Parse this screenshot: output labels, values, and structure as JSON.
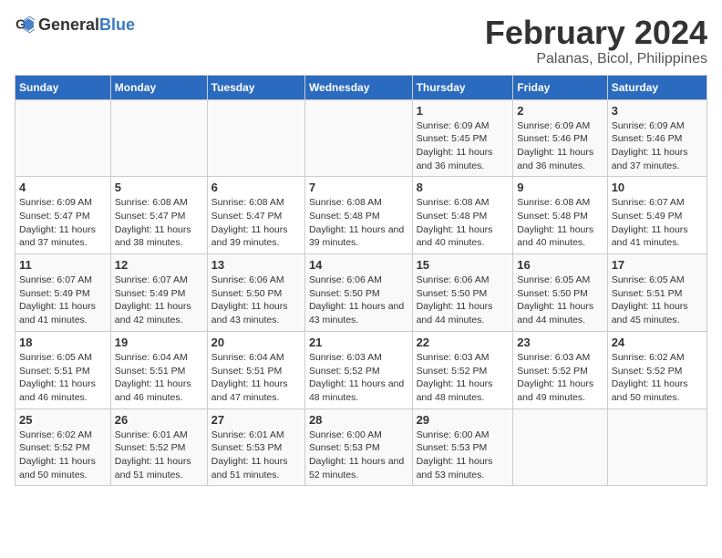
{
  "header": {
    "logo_general": "General",
    "logo_blue": "Blue",
    "month_title": "February 2024",
    "location": "Palanas, Bicol, Philippines"
  },
  "calendar": {
    "days_of_week": [
      "Sunday",
      "Monday",
      "Tuesday",
      "Wednesday",
      "Thursday",
      "Friday",
      "Saturday"
    ],
    "weeks": [
      [
        {
          "day": "",
          "detail": ""
        },
        {
          "day": "",
          "detail": ""
        },
        {
          "day": "",
          "detail": ""
        },
        {
          "day": "",
          "detail": ""
        },
        {
          "day": "1",
          "detail": "Sunrise: 6:09 AM\nSunset: 5:45 PM\nDaylight: 11 hours and 36 minutes."
        },
        {
          "day": "2",
          "detail": "Sunrise: 6:09 AM\nSunset: 5:46 PM\nDaylight: 11 hours and 36 minutes."
        },
        {
          "day": "3",
          "detail": "Sunrise: 6:09 AM\nSunset: 5:46 PM\nDaylight: 11 hours and 37 minutes."
        }
      ],
      [
        {
          "day": "4",
          "detail": "Sunrise: 6:09 AM\nSunset: 5:47 PM\nDaylight: 11 hours and 37 minutes."
        },
        {
          "day": "5",
          "detail": "Sunrise: 6:08 AM\nSunset: 5:47 PM\nDaylight: 11 hours and 38 minutes."
        },
        {
          "day": "6",
          "detail": "Sunrise: 6:08 AM\nSunset: 5:47 PM\nDaylight: 11 hours and 39 minutes."
        },
        {
          "day": "7",
          "detail": "Sunrise: 6:08 AM\nSunset: 5:48 PM\nDaylight: 11 hours and 39 minutes."
        },
        {
          "day": "8",
          "detail": "Sunrise: 6:08 AM\nSunset: 5:48 PM\nDaylight: 11 hours and 40 minutes."
        },
        {
          "day": "9",
          "detail": "Sunrise: 6:08 AM\nSunset: 5:48 PM\nDaylight: 11 hours and 40 minutes."
        },
        {
          "day": "10",
          "detail": "Sunrise: 6:07 AM\nSunset: 5:49 PM\nDaylight: 11 hours and 41 minutes."
        }
      ],
      [
        {
          "day": "11",
          "detail": "Sunrise: 6:07 AM\nSunset: 5:49 PM\nDaylight: 11 hours and 41 minutes."
        },
        {
          "day": "12",
          "detail": "Sunrise: 6:07 AM\nSunset: 5:49 PM\nDaylight: 11 hours and 42 minutes."
        },
        {
          "day": "13",
          "detail": "Sunrise: 6:06 AM\nSunset: 5:50 PM\nDaylight: 11 hours and 43 minutes."
        },
        {
          "day": "14",
          "detail": "Sunrise: 6:06 AM\nSunset: 5:50 PM\nDaylight: 11 hours and 43 minutes."
        },
        {
          "day": "15",
          "detail": "Sunrise: 6:06 AM\nSunset: 5:50 PM\nDaylight: 11 hours and 44 minutes."
        },
        {
          "day": "16",
          "detail": "Sunrise: 6:05 AM\nSunset: 5:50 PM\nDaylight: 11 hours and 44 minutes."
        },
        {
          "day": "17",
          "detail": "Sunrise: 6:05 AM\nSunset: 5:51 PM\nDaylight: 11 hours and 45 minutes."
        }
      ],
      [
        {
          "day": "18",
          "detail": "Sunrise: 6:05 AM\nSunset: 5:51 PM\nDaylight: 11 hours and 46 minutes."
        },
        {
          "day": "19",
          "detail": "Sunrise: 6:04 AM\nSunset: 5:51 PM\nDaylight: 11 hours and 46 minutes."
        },
        {
          "day": "20",
          "detail": "Sunrise: 6:04 AM\nSunset: 5:51 PM\nDaylight: 11 hours and 47 minutes."
        },
        {
          "day": "21",
          "detail": "Sunrise: 6:03 AM\nSunset: 5:52 PM\nDaylight: 11 hours and 48 minutes."
        },
        {
          "day": "22",
          "detail": "Sunrise: 6:03 AM\nSunset: 5:52 PM\nDaylight: 11 hours and 48 minutes."
        },
        {
          "day": "23",
          "detail": "Sunrise: 6:03 AM\nSunset: 5:52 PM\nDaylight: 11 hours and 49 minutes."
        },
        {
          "day": "24",
          "detail": "Sunrise: 6:02 AM\nSunset: 5:52 PM\nDaylight: 11 hours and 50 minutes."
        }
      ],
      [
        {
          "day": "25",
          "detail": "Sunrise: 6:02 AM\nSunset: 5:52 PM\nDaylight: 11 hours and 50 minutes."
        },
        {
          "day": "26",
          "detail": "Sunrise: 6:01 AM\nSunset: 5:52 PM\nDaylight: 11 hours and 51 minutes."
        },
        {
          "day": "27",
          "detail": "Sunrise: 6:01 AM\nSunset: 5:53 PM\nDaylight: 11 hours and 51 minutes."
        },
        {
          "day": "28",
          "detail": "Sunrise: 6:00 AM\nSunset: 5:53 PM\nDaylight: 11 hours and 52 minutes."
        },
        {
          "day": "29",
          "detail": "Sunrise: 6:00 AM\nSunset: 5:53 PM\nDaylight: 11 hours and 53 minutes."
        },
        {
          "day": "",
          "detail": ""
        },
        {
          "day": "",
          "detail": ""
        }
      ]
    ]
  }
}
